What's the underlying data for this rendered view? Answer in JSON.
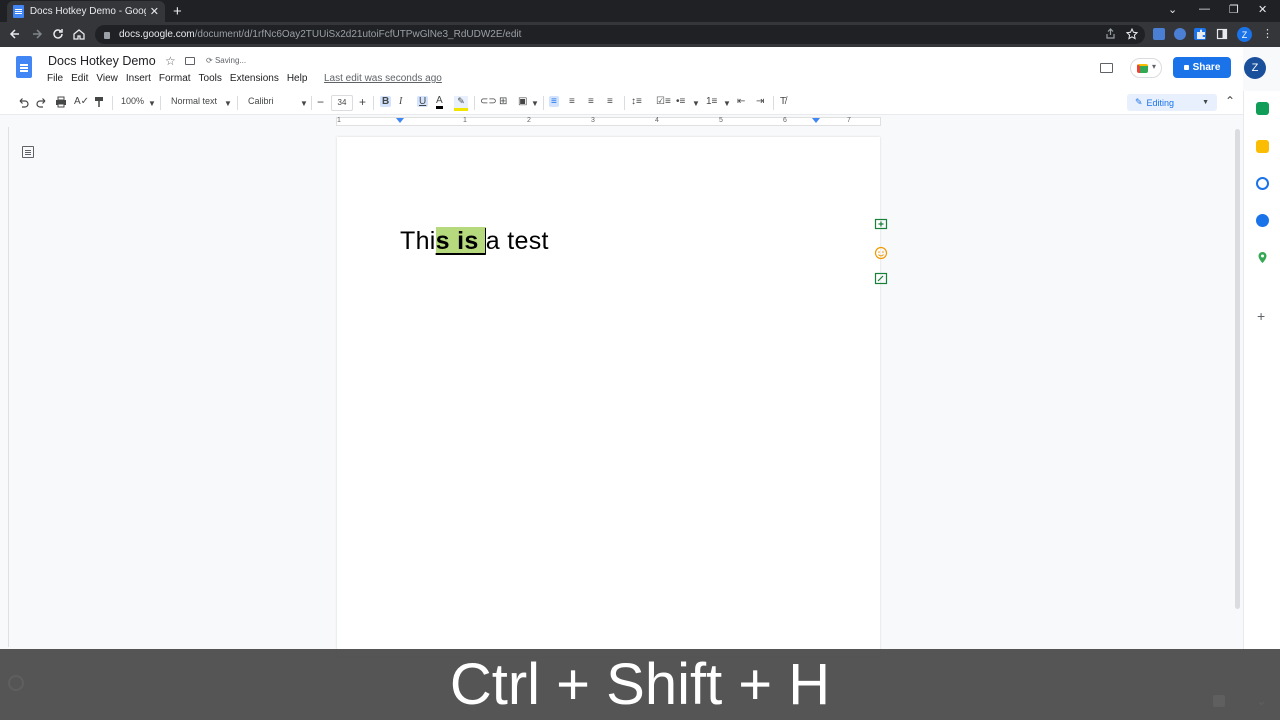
{
  "browser": {
    "tab_title": "Docs Hotkey Demo - Google Docs",
    "tab_close": "✕",
    "new_tab": "+",
    "url_domain": "docs.google.com",
    "url_path": "/document/d/1rfNc6Oay2TUUiSx2d21utoiFcfUTPwGlNe3_RdUDW2E/edit",
    "profile_initial": "Z"
  },
  "docs": {
    "title": "Docs Hotkey Demo",
    "saving_status": "Saving...",
    "menu": [
      "File",
      "Edit",
      "View",
      "Insert",
      "Format",
      "Tools",
      "Extensions",
      "Help"
    ],
    "last_edit": "Last edit was seconds ago",
    "share_label": "Share",
    "avatar_initial": "Z"
  },
  "toolbar": {
    "zoom": "100%",
    "style": "Normal text",
    "font": "Calibri",
    "font_size": "34",
    "bold": "B",
    "italic": "I",
    "underline": "U",
    "text_color": "A",
    "mode": "Editing"
  },
  "ruler": {
    "numbers": [
      "1",
      "1",
      "2",
      "3",
      "4",
      "5",
      "6",
      "7"
    ]
  },
  "document": {
    "text_before": "Thi",
    "text_selected": "s is ",
    "text_after": "a test"
  },
  "overlay": {
    "hotkey": "Ctrl + Shift + H"
  },
  "colors": {
    "accent": "#1a73e8",
    "highlight": "#b7d97d"
  }
}
